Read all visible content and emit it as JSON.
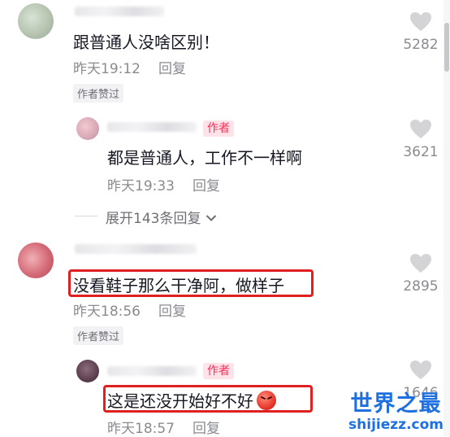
{
  "comments": [
    {
      "text": "跟普通人没啥区别！",
      "time": "昨天19:12",
      "reply_label": "回复",
      "liked_tag": "作者赞过",
      "like_count": "5282"
    },
    {
      "author_tag": "作者",
      "text": "都是普通人，工作不一样啊",
      "time": "昨天19:33",
      "reply_label": "回复",
      "like_count": "3621"
    },
    {
      "expand_label": "展开143条回复",
      "expand_icon": "chevron-down-icon"
    },
    {
      "text": "没看鞋子那么干净阿，做样子",
      "time": "昨天18:56",
      "reply_label": "回复",
      "liked_tag": "作者赞过",
      "like_count": "2895"
    },
    {
      "author_tag": "作者",
      "text": "这是还没开始好不好",
      "emoji": "angry-face-icon",
      "time": "昨天18:57",
      "reply_label": "回复",
      "like_count": "1646"
    }
  ],
  "watermark": {
    "title": "世界之最",
    "url": "shijiezz.com"
  },
  "colors": {
    "accent": "#fe2c55",
    "highlight": "#e02020",
    "watermark": "#1e6fe0",
    "meta": "#8a8b91"
  }
}
